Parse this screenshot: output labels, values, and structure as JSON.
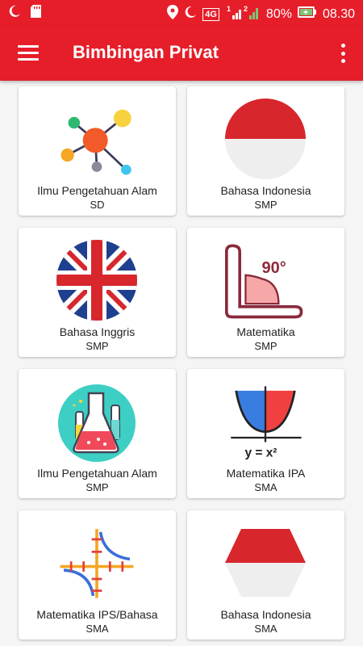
{
  "status_bar": {
    "battery_percent": "80%",
    "time": "08.30",
    "network": "4G",
    "sim1": "1",
    "sim2": "2",
    "icons": [
      "moon-icon",
      "sd-card-icon",
      "location-icon",
      "moon-icon",
      "signal-icon",
      "battery-charging-icon"
    ]
  },
  "app_bar": {
    "title": "Bimbingan Privat",
    "menu_icon": "hamburger-menu-icon",
    "overflow_icon": "more-vert-icon"
  },
  "colors": {
    "primary": "#e61e2a",
    "card_bg": "#ffffff",
    "page_bg": "#f5f5f5"
  },
  "courses": [
    {
      "title": "Ilmu Pengetahuan Alam",
      "level": "SD",
      "icon": "molecule-icon"
    },
    {
      "title": "Bahasa Indonesia",
      "level": "SMP",
      "icon": "indonesia-flag-icon"
    },
    {
      "title": "Bahasa Inggris",
      "level": "SMP",
      "icon": "uk-flag-icon"
    },
    {
      "title": "Matematika",
      "level": "SMP",
      "icon": "angle-90-icon"
    },
    {
      "title": "Ilmu Pengetahuan Alam",
      "level": "SMP",
      "icon": "lab-flask-icon"
    },
    {
      "title": "Matematika IPA",
      "level": "SMA",
      "icon": "parabola-graph-icon"
    },
    {
      "title": "Matematika IPS/Bahasa",
      "level": "SMA",
      "icon": "graph-axes-icon"
    },
    {
      "title": "Bahasa Indonesia",
      "level": "SMA",
      "icon": "indonesia-hexagon-icon"
    }
  ]
}
